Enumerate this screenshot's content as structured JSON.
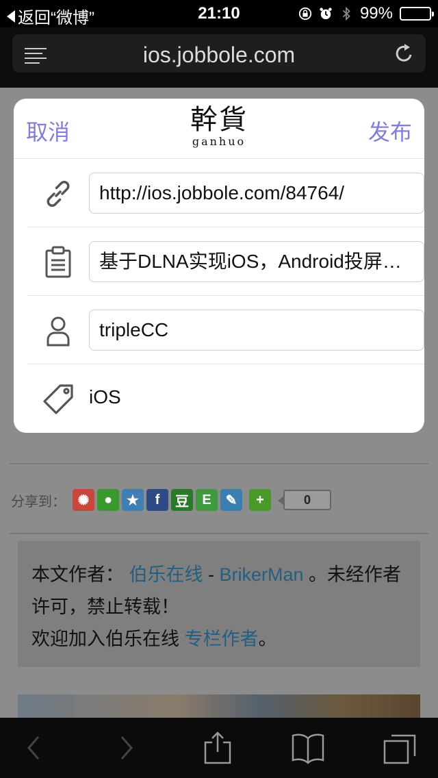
{
  "status_bar": {
    "back_label": "返回“微博”",
    "time": "21:10",
    "battery_percent": "99%",
    "battery_level": 0.99,
    "battery_color": "#4cd964",
    "icons": [
      "rotation-lock-icon",
      "alarm-icon",
      "bluetooth-icon"
    ]
  },
  "browser": {
    "url": "ios.jobbole.com"
  },
  "modal": {
    "cancel_label": "取消",
    "publish_label": "发布",
    "logo_cn": "幹貨",
    "logo_en": "ganhuo",
    "accent_color": "#7f7dde",
    "link_value": "http://ios.jobbole.com/84764/",
    "title_value": "基于DLNA实现iOS，Android投屏：SSDP发现设备",
    "author_value": "tripleCC",
    "tag_value": "iOS"
  },
  "page": {
    "share_label": "分享到：",
    "share_count": "0",
    "author_prefix": "本文作者：",
    "author_site": "伯乐在线",
    "author_sep": " - ",
    "author_name": "BrikerMan",
    "author_suffix": " 。未经作者许可，禁止转载！",
    "join_text": "欢迎加入伯乐在线",
    "join_link": "专栏作者",
    "join_end": "。"
  }
}
